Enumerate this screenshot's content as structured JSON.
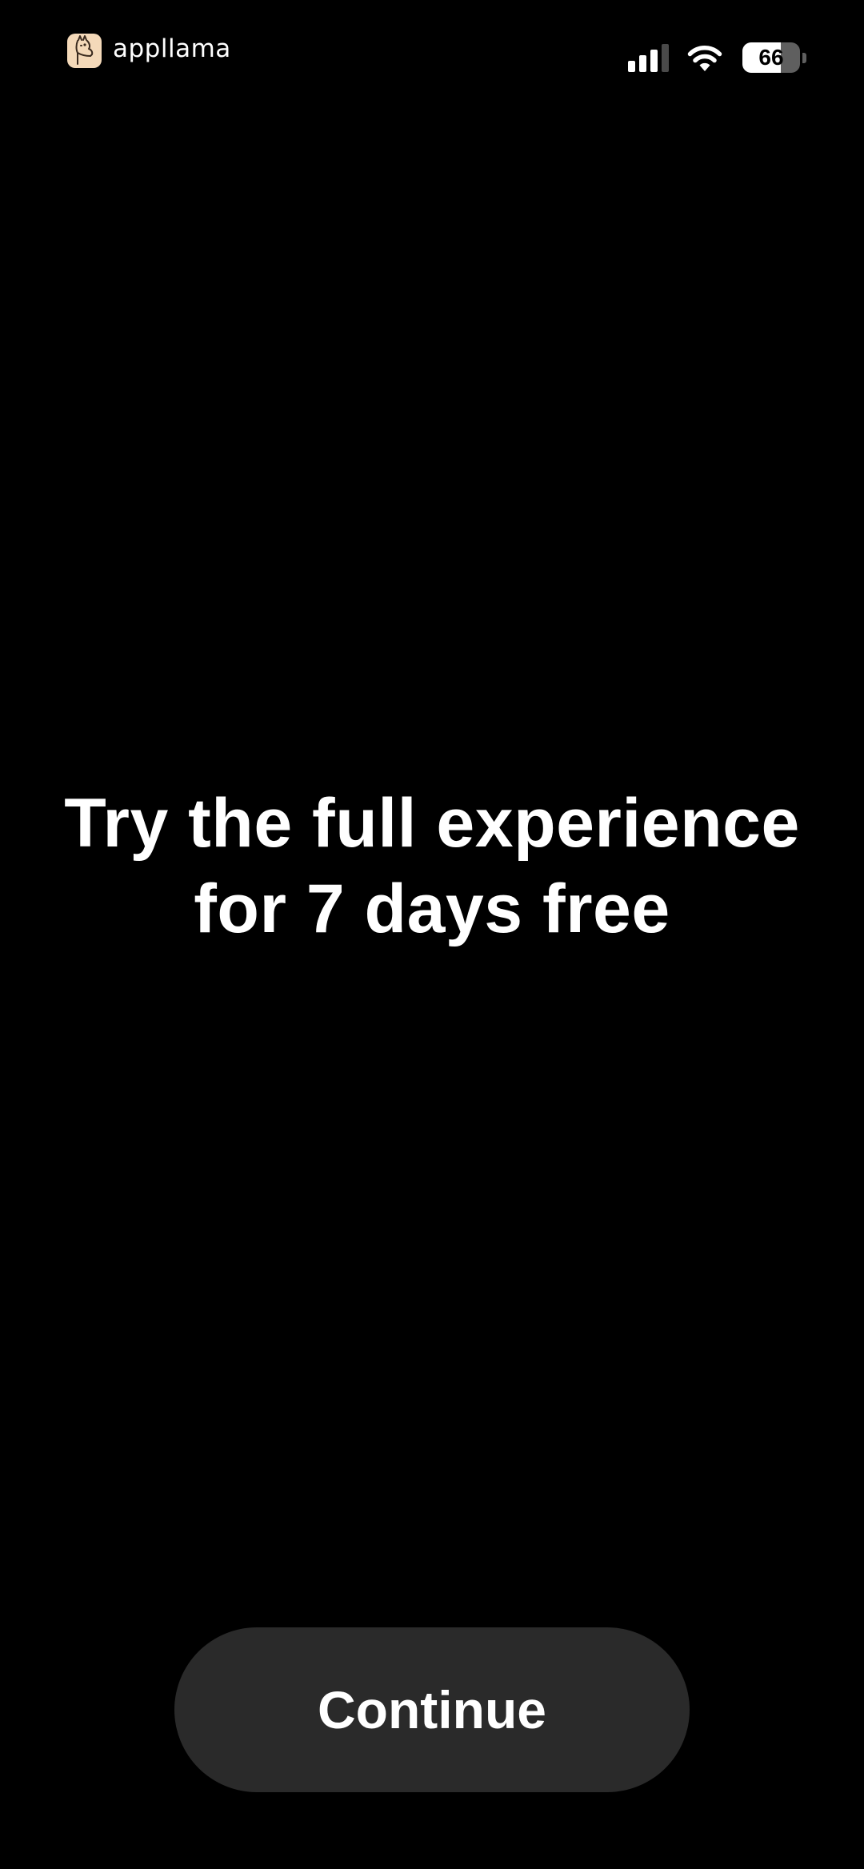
{
  "status_bar": {
    "brand_name": "appllama",
    "brand_logo_icon": "llama-icon",
    "signal_icon": "cellular-signal-icon",
    "wifi_icon": "wifi-icon",
    "battery_level": "66",
    "battery_fraction": 0.66
  },
  "main": {
    "headline_line1": "Try the full experience",
    "headline_line2": "for 7 days free"
  },
  "footer": {
    "continue_label": "Continue"
  },
  "colors": {
    "background": "#000000",
    "text": "#ffffff",
    "button_background": "#2a2a2a",
    "brand_logo_background": "#f4d9b9"
  }
}
